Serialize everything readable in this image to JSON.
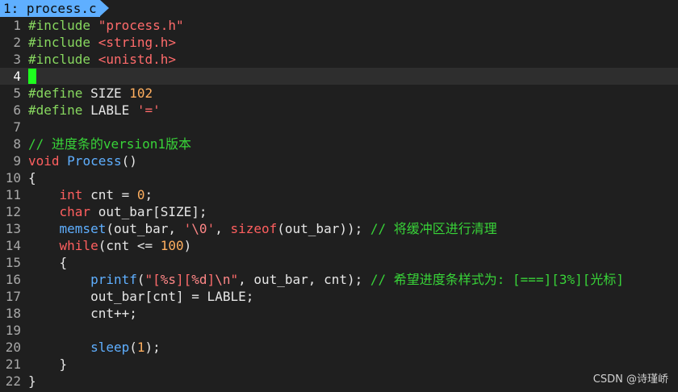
{
  "tab": {
    "label": "1: process.c"
  },
  "colors": {
    "background": "#1f1f1f",
    "tab": "#5fafff",
    "preprocessor": "#87d75f",
    "string": "#ff6b6b",
    "type": "#ff5f5f",
    "function": "#5fafff",
    "number": "#ffaf5f",
    "comment": "#38d338",
    "cursor": "#1eff1e"
  },
  "cursor_line": 4,
  "lines": [
    {
      "num": "1",
      "tokens": [
        [
          "pre",
          "#include"
        ],
        [
          "plain",
          " "
        ],
        [
          "str",
          "\"process.h\""
        ]
      ]
    },
    {
      "num": "2",
      "tokens": [
        [
          "pre",
          "#include"
        ],
        [
          "plain",
          " "
        ],
        [
          "str",
          "<string.h>"
        ]
      ]
    },
    {
      "num": "3",
      "tokens": [
        [
          "pre",
          "#include"
        ],
        [
          "plain",
          " "
        ],
        [
          "str",
          "<unistd.h>"
        ]
      ]
    },
    {
      "num": "4",
      "tokens": []
    },
    {
      "num": "5",
      "tokens": [
        [
          "pre",
          "#define"
        ],
        [
          "plain",
          " SIZE "
        ],
        [
          "num",
          "102"
        ]
      ]
    },
    {
      "num": "6",
      "tokens": [
        [
          "pre",
          "#define"
        ],
        [
          "plain",
          " LABLE "
        ],
        [
          "str",
          "'='"
        ]
      ]
    },
    {
      "num": "7",
      "tokens": []
    },
    {
      "num": "8",
      "tokens": [
        [
          "cmt",
          "// 进度条的version1版本"
        ]
      ]
    },
    {
      "num": "9",
      "tokens": [
        [
          "type",
          "void"
        ],
        [
          "plain",
          " "
        ],
        [
          "func",
          "Process"
        ],
        [
          "plain",
          "()"
        ]
      ]
    },
    {
      "num": "10",
      "tokens": [
        [
          "plain",
          "{"
        ]
      ]
    },
    {
      "num": "11",
      "tokens": [
        [
          "plain",
          "    "
        ],
        [
          "type",
          "int"
        ],
        [
          "plain",
          " cnt = "
        ],
        [
          "num",
          "0"
        ],
        [
          "plain",
          ";"
        ]
      ]
    },
    {
      "num": "12",
      "tokens": [
        [
          "plain",
          "    "
        ],
        [
          "type",
          "char"
        ],
        [
          "plain",
          " out_bar[SIZE];"
        ]
      ]
    },
    {
      "num": "13",
      "tokens": [
        [
          "plain",
          "    "
        ],
        [
          "func",
          "memset"
        ],
        [
          "plain",
          "(out_bar, "
        ],
        [
          "str",
          "'"
        ],
        [
          "esc",
          "\\0"
        ],
        [
          "str",
          "'"
        ],
        [
          "plain",
          ", "
        ],
        [
          "type",
          "sizeof"
        ],
        [
          "plain",
          "(out_bar)); "
        ],
        [
          "cmt",
          "// 将缓冲区进行清理"
        ]
      ]
    },
    {
      "num": "14",
      "tokens": [
        [
          "plain",
          "    "
        ],
        [
          "type",
          "while"
        ],
        [
          "plain",
          "(cnt <= "
        ],
        [
          "num",
          "100"
        ],
        [
          "plain",
          ")"
        ]
      ]
    },
    {
      "num": "15",
      "tokens": [
        [
          "plain",
          "    {"
        ]
      ]
    },
    {
      "num": "16",
      "tokens": [
        [
          "plain",
          "        "
        ],
        [
          "func",
          "printf"
        ],
        [
          "plain",
          "("
        ],
        [
          "str",
          "\"["
        ],
        [
          "esc",
          "%s"
        ],
        [
          "str",
          "]["
        ],
        [
          "esc",
          "%d"
        ],
        [
          "str",
          "]"
        ],
        [
          "esc",
          "\\n"
        ],
        [
          "str",
          "\""
        ],
        [
          "plain",
          ", out_bar, cnt); "
        ],
        [
          "cmt",
          "// 希望进度条样式为: [===][3%][光标]"
        ]
      ]
    },
    {
      "num": "17",
      "tokens": [
        [
          "plain",
          "        out_bar[cnt] = LABLE;"
        ]
      ]
    },
    {
      "num": "18",
      "tokens": [
        [
          "plain",
          "        cnt++;"
        ]
      ]
    },
    {
      "num": "19",
      "tokens": []
    },
    {
      "num": "20",
      "tokens": [
        [
          "plain",
          "        "
        ],
        [
          "func",
          "sleep"
        ],
        [
          "plain",
          "("
        ],
        [
          "num",
          "1"
        ],
        [
          "plain",
          ");"
        ]
      ]
    },
    {
      "num": "21",
      "tokens": [
        [
          "plain",
          "    }"
        ]
      ]
    },
    {
      "num": "22",
      "tokens": [
        [
          "plain",
          "}"
        ]
      ]
    }
  ],
  "watermark": "CSDN @诗瑾峤"
}
